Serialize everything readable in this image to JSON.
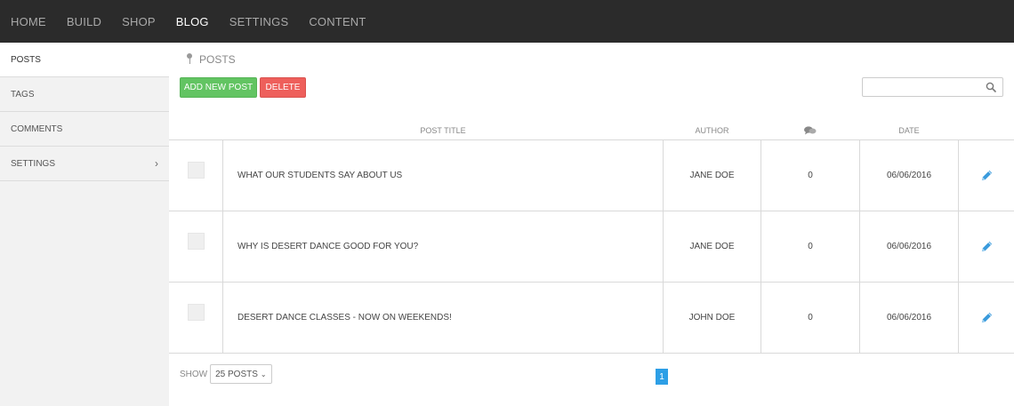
{
  "nav": {
    "items": [
      {
        "label": "HOME"
      },
      {
        "label": "BUILD"
      },
      {
        "label": "SHOP"
      },
      {
        "label": "BLOG",
        "active": true
      },
      {
        "label": "SETTINGS"
      },
      {
        "label": "CONTENT"
      }
    ]
  },
  "sidebar": {
    "items": [
      {
        "label": "POSTS",
        "active": true
      },
      {
        "label": "TAGS"
      },
      {
        "label": "COMMENTS"
      },
      {
        "label": "SETTINGS",
        "has_submenu": true
      }
    ],
    "chevron": "›"
  },
  "breadcrumb": {
    "icon": "pin-icon",
    "label": "POSTS"
  },
  "toolbar": {
    "add_label": "ADD NEW POST",
    "delete_label": "DELETE",
    "add_color": "#62c462",
    "delete_color": "#ee5f5b"
  },
  "search": {
    "placeholder": "",
    "value": "",
    "icon": "search-icon"
  },
  "table": {
    "headers": {
      "title": "POST TITLE",
      "author": "AUTHOR",
      "comments_icon": "comment-icon",
      "date": "DATE"
    },
    "rows": [
      {
        "title": "WHAT OUR STUDENTS SAY ABOUT US",
        "author": "JANE DOE",
        "comments": "0",
        "date": "06/06/2016"
      },
      {
        "title": "WHY IS DESERT DANCE GOOD FOR YOU?",
        "author": "JANE DOE",
        "comments": "0",
        "date": "06/06/2016"
      },
      {
        "title": "DESERT DANCE CLASSES - NOW ON WEEKENDS!",
        "author": "JOHN DOE",
        "comments": "0",
        "date": "06/06/2016"
      }
    ]
  },
  "footer": {
    "show_label": "SHOW",
    "per_page": "25 POSTS",
    "current_page": "1",
    "accent": "#2d9fe6"
  }
}
